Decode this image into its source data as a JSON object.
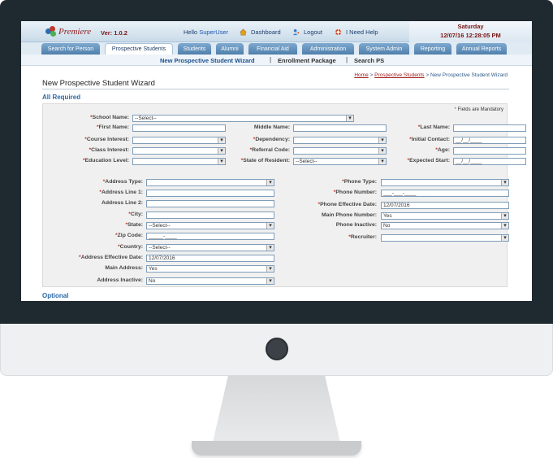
{
  "header": {
    "logo_text": "Premiere",
    "version": "Ver: 1.0.2",
    "hello": "Hello",
    "username": "SuperUser",
    "links": [
      "Dashboard",
      "Logout",
      "I Need Help"
    ],
    "day": "Saturday",
    "datetime": "12/07/16   12:28:05 PM"
  },
  "nav": {
    "tabs": [
      "Search for Person",
      "Prospective Students",
      "Students",
      "Alumni",
      "Financial Aid",
      "Administration",
      "System Admin",
      "Reporting",
      "Annual Reports"
    ],
    "active": "Prospective Students"
  },
  "subnav": [
    "New Prospective Student Wizard",
    "Enrollment Package",
    "Search PS"
  ],
  "breadcrumb": {
    "home": "Home",
    "section": "Prospective Students",
    "current": "New Prospective Student Wizard",
    "sep": " > "
  },
  "page_title": "New Prospective Student Wizard",
  "sections": {
    "required": "All Required",
    "optional": "Optional"
  },
  "mandatory_note": "Fields are Mandatory",
  "fields": {
    "school_name": {
      "label": "School Name:",
      "value": "--Select--"
    },
    "first_name": {
      "label": "First Name:",
      "value": ""
    },
    "middle_name": {
      "label": "Middle Name:",
      "value": ""
    },
    "last_name": {
      "label": "Last Name:",
      "value": ""
    },
    "course_interest": {
      "label": "Course Interest:",
      "value": ""
    },
    "dependency": {
      "label": "Dependency:",
      "value": ""
    },
    "initial_contact": {
      "label": "Initial Contact:",
      "value": "__/__/____"
    },
    "class_interest": {
      "label": "Class Interest:",
      "value": ""
    },
    "referral_code": {
      "label": "Referral Code:",
      "value": ""
    },
    "age": {
      "label": "Age:",
      "value": ""
    },
    "education_level": {
      "label": "Education Level:",
      "value": ""
    },
    "state_of_resident": {
      "label": "State of Resident:",
      "value": "--Select--"
    },
    "expected_start": {
      "label": "Expected Start:",
      "value": "__/__/____"
    },
    "address_type": {
      "label": "Address Type:",
      "value": ""
    },
    "address_line_1": {
      "label": "Address Line 1:",
      "value": ""
    },
    "address_line_2": {
      "label": "Address Line 2:",
      "value": ""
    },
    "city": {
      "label": "City:",
      "value": ""
    },
    "state": {
      "label": "State:",
      "value": "--Select--"
    },
    "zip_code": {
      "label": "Zip Code:",
      "value": "_____-____"
    },
    "country": {
      "label": "Country:",
      "value": "--Select--"
    },
    "address_effective_date": {
      "label": "Address Effective Date:",
      "value": "12/07/2016"
    },
    "main_address": {
      "label": "Main Address:",
      "value": "Yes"
    },
    "address_inactive": {
      "label": "Address Inactive:",
      "value": "No"
    },
    "phone_type": {
      "label": "Phone Type:",
      "value": ""
    },
    "phone_number": {
      "label": "Phone Number:",
      "value": "___-___-____"
    },
    "phone_effective_date": {
      "label": "Phone Effective Date:",
      "value": "12/07/2016"
    },
    "main_phone_number": {
      "label": "Main Phone Number:",
      "value": "Yes"
    },
    "phone_inactive": {
      "label": "Phone Inactive:",
      "value": "No"
    },
    "recruiter": {
      "label": "Recruiter:",
      "value": ""
    }
  },
  "colors": {
    "nav_tab": "#4f7fac",
    "accent_red": "#a11d1d",
    "section_blue": "#2a6aa8"
  }
}
